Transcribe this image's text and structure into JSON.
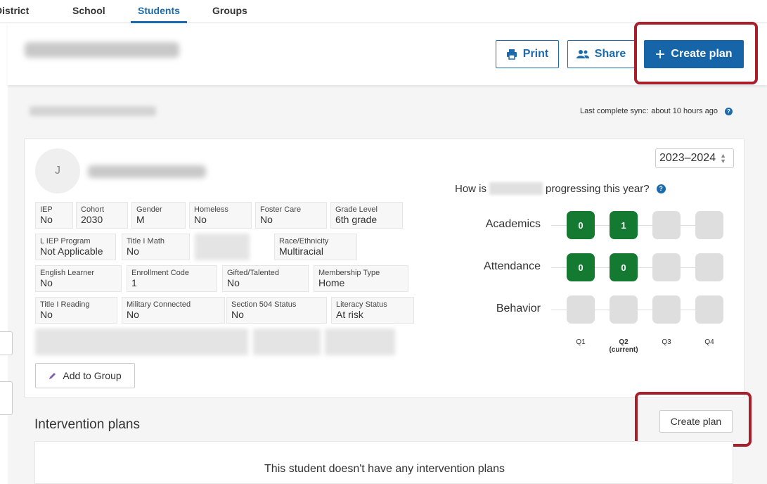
{
  "topnav": {
    "tabs": [
      {
        "label": "District",
        "active": false
      },
      {
        "label": "School",
        "active": false
      },
      {
        "label": "Students",
        "active": true
      },
      {
        "label": "Groups",
        "active": false
      }
    ]
  },
  "header": {
    "print_label": "Print",
    "share_label": "Share",
    "create_plan_label": "Create plan"
  },
  "sync": {
    "label": "Last complete sync:",
    "value": "about 10 hours ago",
    "info_symbol": "?"
  },
  "student": {
    "avatar_initial": "J",
    "fields": [
      {
        "label": "IEP",
        "value": "No"
      },
      {
        "label": "Cohort",
        "value": "2030"
      },
      {
        "label": "Gender",
        "value": "M"
      },
      {
        "label": "Homeless",
        "value": "No"
      },
      {
        "label": "Foster Care",
        "value": "No"
      },
      {
        "label": "Grade Level",
        "value": "6th grade"
      },
      {
        "label": "L IEP Program",
        "value": "Not Applicable"
      },
      {
        "label": "Title I Math",
        "value": "No"
      },
      {
        "label": "Race/Ethnicity",
        "value": "Multiracial"
      },
      {
        "label": "English Learner",
        "value": "No"
      },
      {
        "label": "Enrollment Code",
        "value": "1"
      },
      {
        "label": "Gifted/Talented",
        "value": "No"
      },
      {
        "label": "Membership Type",
        "value": "Home"
      },
      {
        "label": "Title I Reading",
        "value": "No"
      },
      {
        "label": "Military Connected",
        "value": "No"
      },
      {
        "label": "Section 504 Status",
        "value": "No"
      },
      {
        "label": "Literacy Status",
        "value": "At risk"
      }
    ],
    "add_group_label": "Add to Group"
  },
  "progress": {
    "year": "2023–2024",
    "question_prefix": "How is",
    "question_suffix": "progressing this year?",
    "info_symbol": "?",
    "rows": [
      {
        "label": "Academics",
        "quarters": [
          "0",
          "1",
          "",
          ""
        ]
      },
      {
        "label": "Attendance",
        "quarters": [
          "0",
          "0",
          "",
          ""
        ]
      },
      {
        "label": "Behavior",
        "quarters": [
          "",
          "",
          "",
          ""
        ]
      }
    ],
    "quarter_labels": [
      {
        "name": "Q1",
        "sub": ""
      },
      {
        "name": "Q2",
        "sub": "(current)"
      },
      {
        "name": "Q3",
        "sub": ""
      },
      {
        "name": "Q4",
        "sub": ""
      }
    ]
  },
  "interventions": {
    "title": "Intervention plans",
    "create_label": "Create plan",
    "empty_message": "This student doesn't have any intervention plans"
  },
  "colors": {
    "accent": "#1565a8",
    "good": "#147a32",
    "highlight": "#a81e2a"
  }
}
